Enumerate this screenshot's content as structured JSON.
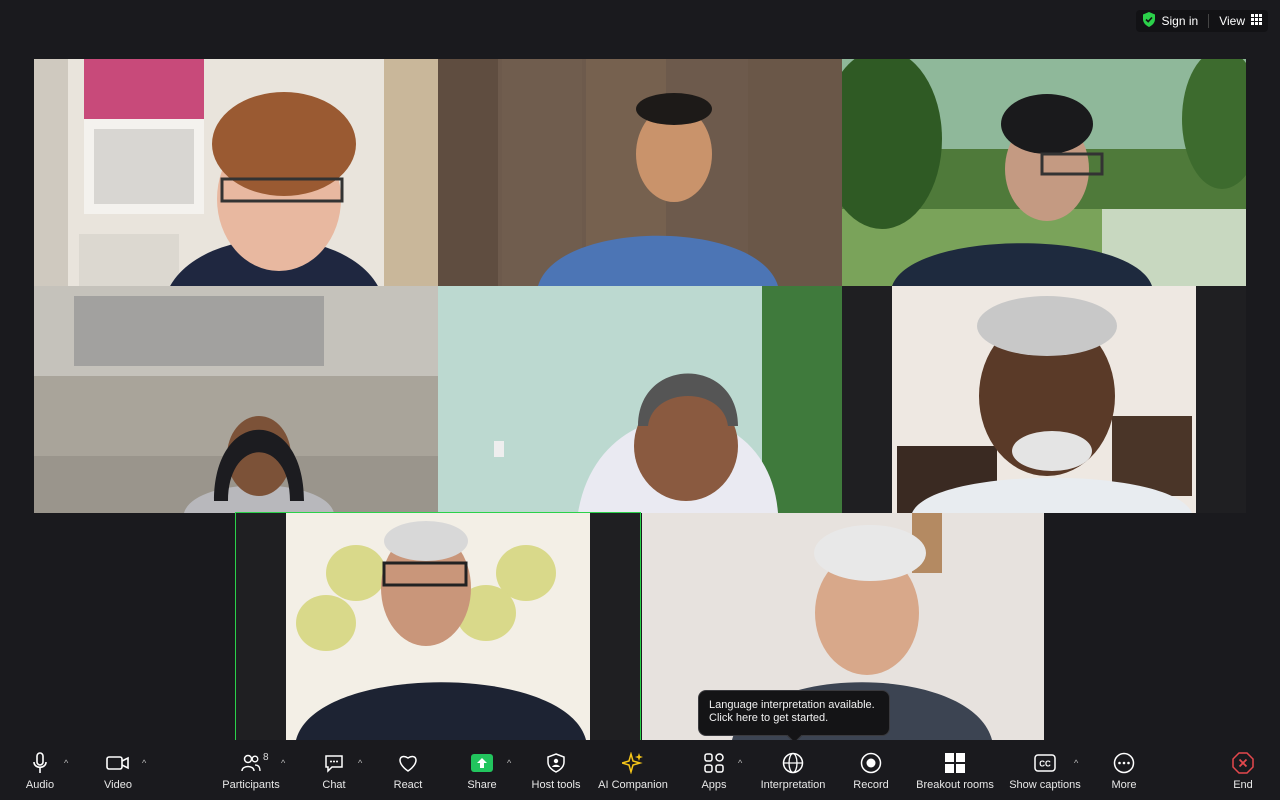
{
  "topbar": {
    "sign_in": "Sign in",
    "view": "View"
  },
  "tooltip": {
    "line1": "Language interpretation available.",
    "line2": "Click here to get started."
  },
  "toolbar": {
    "audio": "Audio",
    "video": "Video",
    "participants": "Participants",
    "participants_count": "8",
    "chat": "Chat",
    "react": "React",
    "share": "Share",
    "host_tools": "Host tools",
    "ai_companion": "AI Companion",
    "apps": "Apps",
    "interpretation": "Interpretation",
    "record": "Record",
    "breakout_rooms": "Breakout rooms",
    "show_captions": "Show captions",
    "more": "More",
    "end": "End"
  },
  "colors": {
    "accent_green": "#2bd14a",
    "share_green": "#22c55e",
    "end_red": "#e5484d",
    "ai_yellow": "#f5c518"
  }
}
